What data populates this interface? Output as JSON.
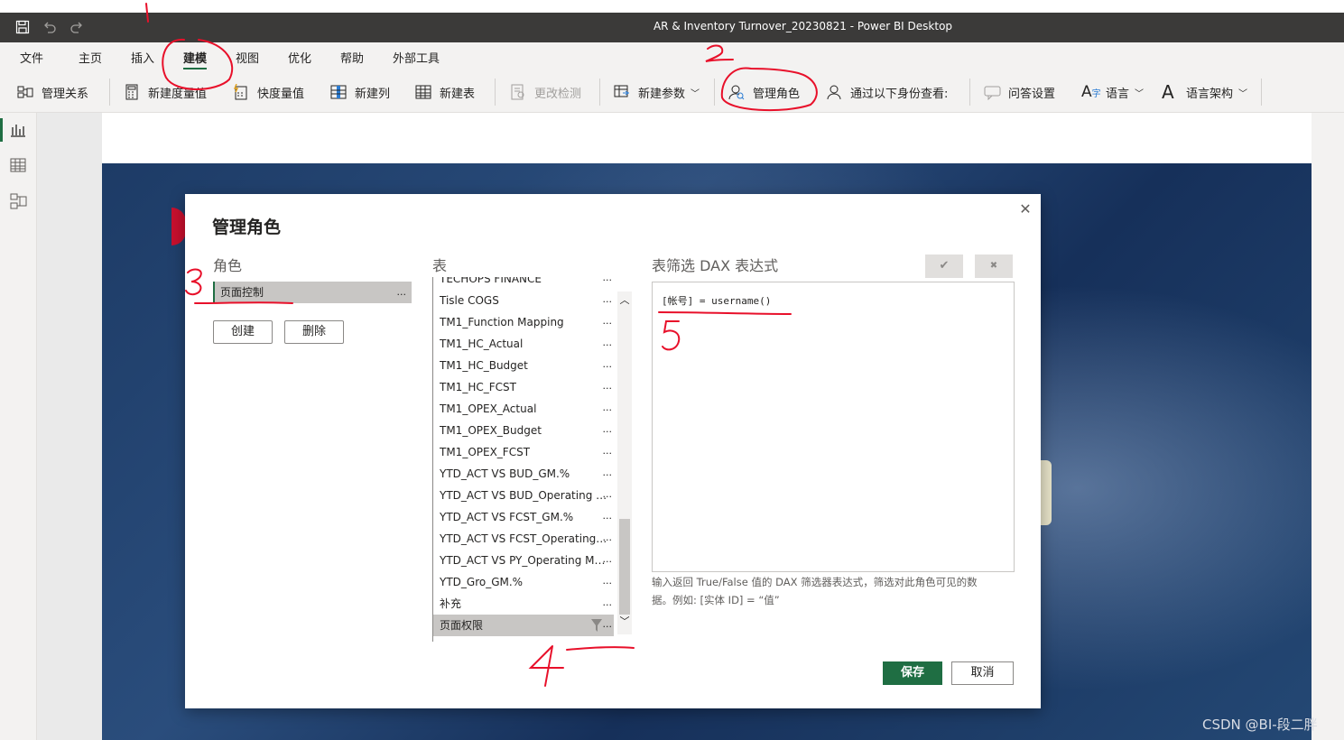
{
  "window": {
    "title": "AR & Inventory Turnover_20230821 - Power BI Desktop"
  },
  "menu": [
    "文件",
    "主页",
    "插入",
    "建模",
    "视图",
    "优化",
    "帮助",
    "外部工具"
  ],
  "ribbon": {
    "manage_relations": "管理关系",
    "new_measure": "新建度量值",
    "quick_measure": "快度量值",
    "new_column": "新建列",
    "new_table": "新建表",
    "change_detection": "更改检测",
    "new_parameter": "新建参数",
    "manage_roles": "管理角色",
    "view_as": "通过以下身份查看:",
    "qa_setup": "问答设置",
    "language": "语言",
    "linguistic_schema": "语言架构"
  },
  "dialog": {
    "title": "管理角色",
    "roles_header": "角色",
    "tables_header": "表",
    "dax_header": "表筛选 DAX 表达式",
    "roles": [
      "页面控制"
    ],
    "role_more": "...",
    "create_label": "创建",
    "delete_label": "删除",
    "tables": [
      "TECHOPS FINANCE",
      "Tisle COGS",
      "TM1_Function Mapping",
      "TM1_HC_Actual",
      "TM1_HC_Budget",
      "TM1_HC_FCST",
      "TM1_OPEX_Actual",
      "TM1_OPEX_Budget",
      "TM1_OPEX_FCST",
      "YTD_ACT VS BUD_GM.%",
      "YTD_ACT VS BUD_Operating Margi",
      "YTD_ACT VS FCST_GM.%",
      "YTD_ACT VS FCST_Operating Marg",
      "YTD_ACT VS PY_Operating Margi",
      "YTD_Gro_GM.%",
      "补充",
      "页面权限"
    ],
    "table_more": "...",
    "confirm_label": "✔",
    "discard_label": "✖",
    "dax_expression": "[帐号] = username()",
    "help_text": "输入返回 True/False 值的 DAX 筛选器表达式，筛选对此角色可见的数据。例如: [实体 ID] = “值”",
    "save_label": "保存",
    "cancel_label": "取消",
    "close_glyph": "✕"
  },
  "annotations": [
    "1",
    "2",
    "3",
    "4",
    "5"
  ],
  "watermark": "CSDN @BI-段二胖",
  "colors": {
    "accent": "#1f6e43",
    "ink": "#e8102a",
    "titlebar": "#3b3a39"
  }
}
